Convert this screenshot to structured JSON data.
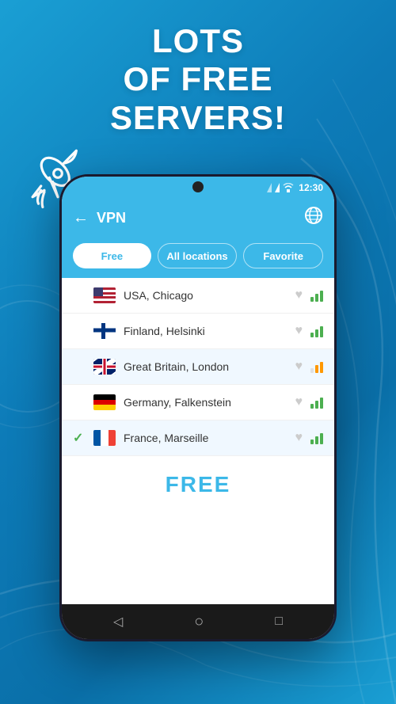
{
  "background": {
    "color_start": "#1a9fd4",
    "color_end": "#0a6fa8"
  },
  "headline": {
    "line1": "Lots",
    "line2": "of free",
    "line3": "servers!"
  },
  "phone": {
    "status_bar": {
      "time": "12:30",
      "signal_icon": "▼▲",
      "wifi_icon": "wifi",
      "battery_icon": "battery"
    },
    "top_bar": {
      "back_label": "←",
      "title": "VPN",
      "globe_label": "🌐"
    },
    "tabs": [
      {
        "id": "free",
        "label": "Free",
        "active": true
      },
      {
        "id": "all",
        "label": "All locations",
        "active": false
      },
      {
        "id": "favorite",
        "label": "Favorite",
        "active": false
      }
    ],
    "servers": [
      {
        "id": "usa",
        "country": "USA",
        "city": "Chicago",
        "name": "USA, Chicago",
        "flag": "usa",
        "selected": false,
        "signal_strength": 3
      },
      {
        "id": "finland",
        "country": "Finland",
        "city": "Helsinki",
        "name": "Finland, Helsinki",
        "flag": "finland",
        "selected": false,
        "signal_strength": 3
      },
      {
        "id": "gb",
        "country": "Great Britain",
        "city": "London",
        "name": "Great Britain, London",
        "flag": "gb",
        "selected": false,
        "signal_strength": 2
      },
      {
        "id": "germany",
        "country": "Germany",
        "city": "Falkenstein",
        "name": "Germany, Falkenstein",
        "flag": "germany",
        "selected": false,
        "signal_strength": 3
      },
      {
        "id": "france",
        "country": "France",
        "city": "Marseille",
        "name": "France, Marseille",
        "flag": "france",
        "selected": true,
        "signal_strength": 3
      }
    ],
    "free_label": "FREE",
    "nav": {
      "back": "◁",
      "home": "○",
      "recent": "□"
    }
  }
}
